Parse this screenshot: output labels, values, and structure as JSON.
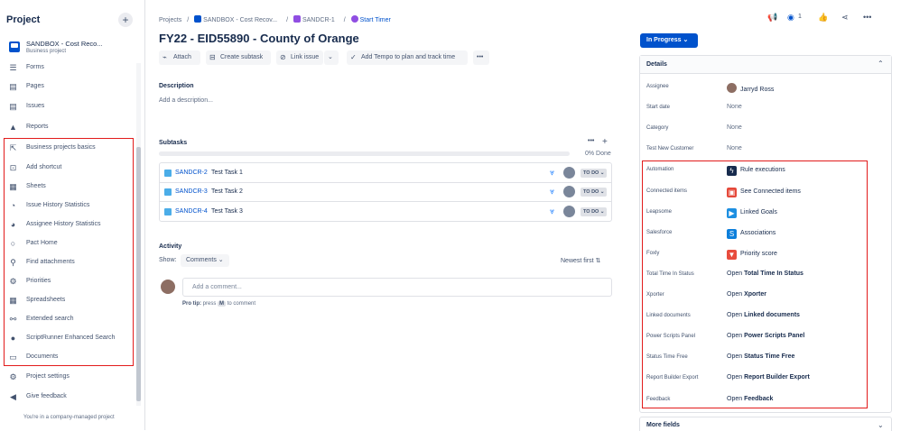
{
  "sidebar": {
    "title": "Project",
    "plus": "+",
    "project_name": "SANDBOX - Cost Reco...",
    "project_type": "Business project",
    "items": [
      {
        "label": "Forms",
        "icon": "☰",
        "icon_name": "forms-icon"
      },
      {
        "label": "Pages",
        "icon": "▤",
        "icon_name": "pages-icon"
      },
      {
        "label": "Issues",
        "icon": "▤",
        "icon_name": "issues-icon"
      },
      {
        "label": "Reports",
        "icon": "▲",
        "icon_name": "reports-icon"
      },
      {
        "label": "Business projects basics",
        "icon": "⇱",
        "icon_name": "external-link-icon"
      },
      {
        "label": "Add shortcut",
        "icon": "⊡",
        "icon_name": "add-shortcut-icon"
      },
      {
        "label": "Sheets",
        "icon": "▦",
        "icon_name": "sheets-icon"
      },
      {
        "label": "Issue History Statistics",
        "icon": "◔",
        "icon_name": "issue-history-icon"
      },
      {
        "label": "Assignee History Statistics",
        "icon": "◕",
        "icon_name": "assignee-history-icon"
      },
      {
        "label": "Pact Home",
        "icon": "○",
        "icon_name": "pact-home-icon"
      },
      {
        "label": "Find attachments",
        "icon": "⚲",
        "icon_name": "search-icon"
      },
      {
        "label": "Priorities",
        "icon": "⚙",
        "icon_name": "priorities-icon"
      },
      {
        "label": "Spreadsheets",
        "icon": "▦",
        "icon_name": "spreadsheets-icon"
      },
      {
        "label": "Extended search",
        "icon": "⚯",
        "icon_name": "extended-search-icon"
      },
      {
        "label": "ScriptRunner Enhanced Search",
        "icon": "●",
        "icon_name": "scriptrunner-icon"
      },
      {
        "label": "Documents",
        "icon": "▭",
        "icon_name": "folder-icon"
      },
      {
        "label": "Project settings",
        "icon": "⚙",
        "icon_name": "gear-icon"
      },
      {
        "label": "Give feedback",
        "icon": "◀",
        "icon_name": "megaphone-icon"
      }
    ],
    "footer": "You're in a company-managed project"
  },
  "main": {
    "breadcrumbs": [
      "Projects",
      "/",
      "SANDBOX - Cost Recov...",
      "/",
      "SANDCR-1",
      "/",
      "Start Timer"
    ],
    "title": "FY22 - EID55890 - County of Orange",
    "toolbar": {
      "attach": "Attach",
      "create_subtask": "Create subtask",
      "link_issue": "Link issue",
      "tempo": "Add Tempo to plan and track time"
    },
    "description_label": "Description",
    "description_placeholder": "Add a description...",
    "subtasks_label": "Subtasks",
    "subtasks_progress_text": "0% Done",
    "subtasks_progress": 0,
    "subtasks": [
      {
        "key": "SANDCR-2",
        "summary": "Test Task 1",
        "status": "TO DO"
      },
      {
        "key": "SANDCR-3",
        "summary": "Test Task 2",
        "status": "TO DO"
      },
      {
        "key": "SANDCR-4",
        "summary": "Test Task 3",
        "status": "TO DO"
      }
    ],
    "activity_label": "Activity",
    "show_label": "Show:",
    "show_value": "Comments",
    "sort_label": "Newest first",
    "comment_placeholder": "Add a comment...",
    "protip_prefix": "Pro tip:",
    "protip_press": "press",
    "protip_key": "M",
    "protip_suffix": "to comment"
  },
  "right": {
    "watch_count": "1",
    "status": "In Progress",
    "details_label": "Details",
    "more_fields_label": "More fields",
    "colors": {
      "accent": "#0052cc",
      "highlight": "#e21b1b"
    },
    "fields": [
      {
        "label": "Assignee",
        "value": "Jarryd Ross",
        "kind": "avatar"
      },
      {
        "label": "Start date",
        "value": "None",
        "kind": "none"
      },
      {
        "label": "Category",
        "value": "None",
        "kind": "none"
      },
      {
        "label": "Test New Customer",
        "value": "None",
        "kind": "none"
      },
      {
        "label": "Automation",
        "value": "Rule executions",
        "kind": "icon",
        "icon": "ϟ",
        "icon_color": "#172b4d",
        "icon_name": "automation-icon"
      },
      {
        "label": "Connected items",
        "value": "See Connected items",
        "kind": "icon",
        "icon": "▣",
        "icon_color": "#e5493a",
        "icon_name": "connected-items-icon"
      },
      {
        "label": "Leapsome",
        "value": "Linked Goals",
        "kind": "icon",
        "icon": "▶",
        "icon_color": "#1d8fe1",
        "icon_name": "leapsome-icon"
      },
      {
        "label": "Salesforce",
        "value": "Associations",
        "kind": "icon",
        "icon": "S",
        "icon_color": "#0d7fdb",
        "icon_name": "salesforce-icon"
      },
      {
        "label": "Foxly",
        "value": "Priority score",
        "kind": "icon",
        "icon": "▼",
        "icon_color": "#e84c3d",
        "icon_name": "foxly-icon"
      },
      {
        "label": "Total Time In Status",
        "prefix": "Open",
        "value": "Total Time In Status",
        "kind": "open"
      },
      {
        "label": "Xporter",
        "prefix": "Open",
        "value": "Xporter",
        "kind": "open"
      },
      {
        "label": "Linked documents",
        "prefix": "Open",
        "value": "Linked documents",
        "kind": "open"
      },
      {
        "label": "Power Scripts Panel",
        "prefix": "Open",
        "value": "Power Scripts Panel",
        "kind": "open"
      },
      {
        "label": "Status Time Free",
        "prefix": "Open",
        "value": "Status Time Free",
        "kind": "open"
      },
      {
        "label": "Report Builder Export",
        "prefix": "Open",
        "value": "Report Builder Export",
        "kind": "open"
      },
      {
        "label": "Feedback",
        "prefix": "Open",
        "value": "Feedback",
        "kind": "open"
      }
    ]
  }
}
